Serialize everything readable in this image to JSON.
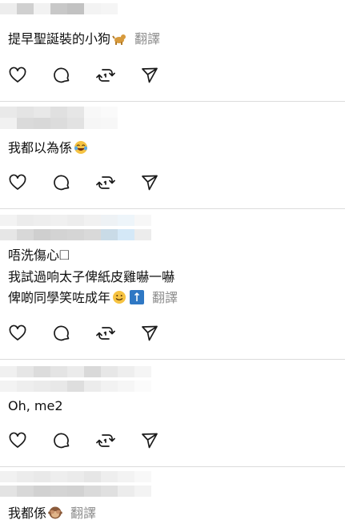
{
  "posts": [
    {
      "lines": [
        "提早聖誕裝的小狗"
      ],
      "translate": "翻譯",
      "emoji": "dog-icon"
    },
    {
      "lines": [
        "我都以為係"
      ],
      "translate": "",
      "emoji": "tears-of-joy-icon"
    },
    {
      "lines": [
        "唔洗傷心🞎",
        "我試過响太子俾紙皮雞嚇一嚇",
        "俾啲同學笑咗成年"
      ],
      "translate": "翻譯",
      "emoji": "smile-icon"
    },
    {
      "lines": [
        "Oh, me2"
      ],
      "translate": "",
      "emoji": ""
    },
    {
      "lines": [
        "我都係"
      ],
      "translate": "翻譯",
      "emoji": "see-no-evil-monkey-icon"
    }
  ],
  "actions": [
    "like-icon",
    "comment-icon",
    "repost-icon",
    "share-icon"
  ],
  "colors": {
    "divider": "#dcdcdc",
    "muted": "#8e8e8e",
    "up_box": "#2f78c4"
  }
}
